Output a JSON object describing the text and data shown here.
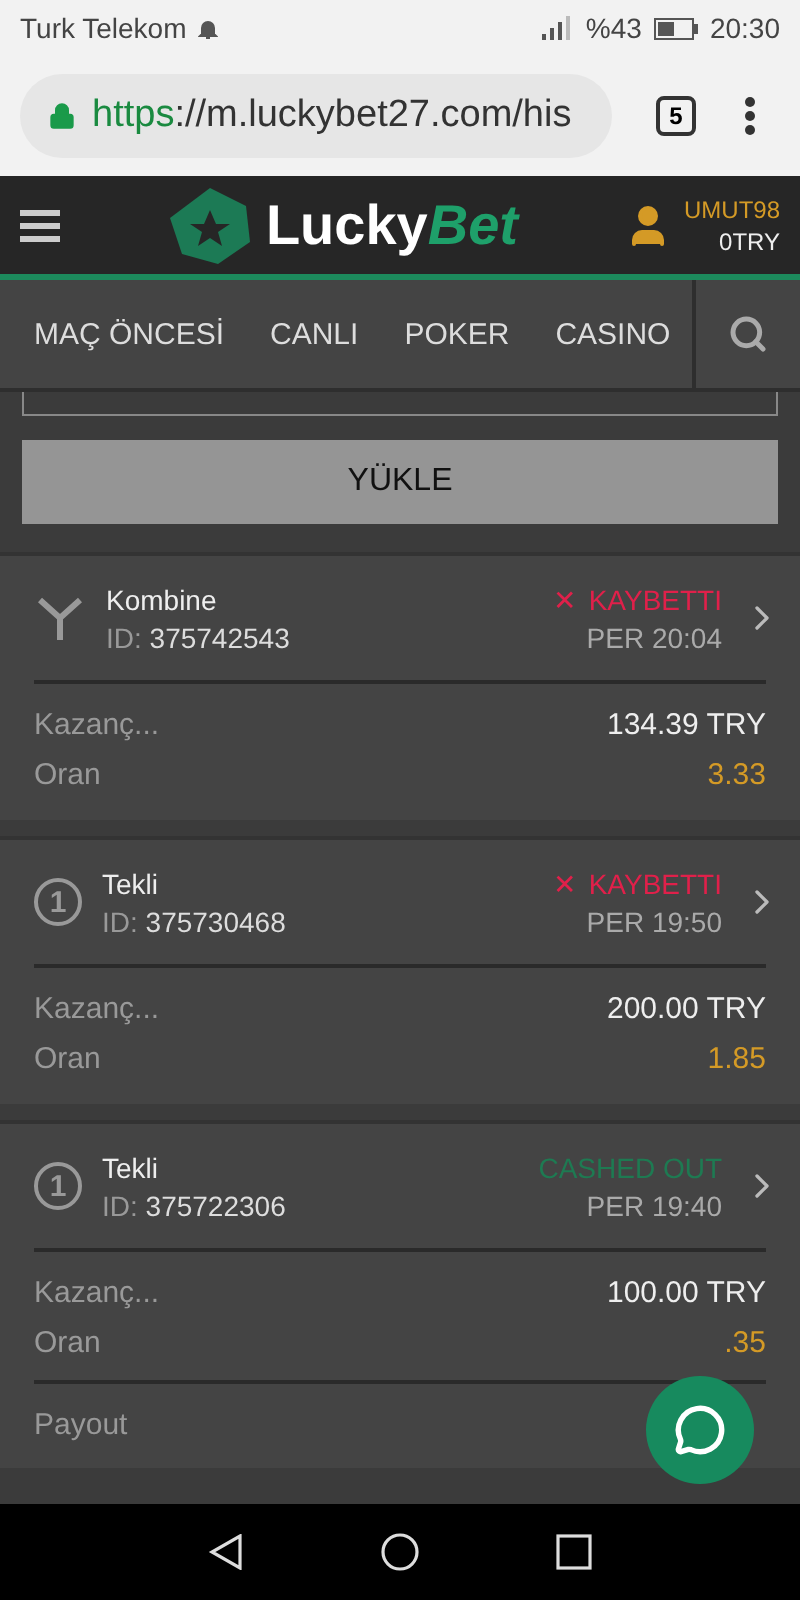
{
  "status_bar": {
    "carrier": "Turk Telekom",
    "battery": "%43",
    "time": "20:30"
  },
  "browser": {
    "url_scheme": "https",
    "url_rest": "://m.luckybet27.com/his",
    "tab_count": "5"
  },
  "header": {
    "logo_first": "Lucky",
    "logo_second": "Bet",
    "username": "UMUT98",
    "balance": "0TRY"
  },
  "nav": [
    {
      "label": "MAÇ ÖNCESİ"
    },
    {
      "label": "CANLI"
    },
    {
      "label": "POKER"
    },
    {
      "label": "CASINO"
    }
  ],
  "load_button": "YÜKLE",
  "bets": [
    {
      "kind": "combo",
      "type": "Kombine",
      "id_label": "ID:",
      "id": "375742543",
      "color": "#e0204a",
      "status_icon": "✕",
      "status_text": "KAYBETTI",
      "date": "PER 20:04",
      "rows": [
        {
          "label": "Kazanç...",
          "value": "134.39 TRY",
          "color": "#eeeeee"
        },
        {
          "label": "Oran",
          "value": "3.33",
          "color": "#d49a26"
        }
      ]
    },
    {
      "kind": "single",
      "type": "Tekli",
      "badge": "1",
      "id_label": "ID:",
      "id": "375730468",
      "color": "#e0204a",
      "status_icon": "✕",
      "status_text": "KAYBETTI",
      "date": "PER 19:50",
      "rows": [
        {
          "label": "Kazanç...",
          "value": "200.00 TRY",
          "color": "#eeeeee"
        },
        {
          "label": "Oran",
          "value": "1.85",
          "color": "#d49a26"
        }
      ]
    },
    {
      "kind": "single",
      "type": "Tekli",
      "badge": "1",
      "id_label": "ID:",
      "id": "375722306",
      "color": "#1e7a52",
      "status_text": "CASHED OUT",
      "date": "PER 19:40",
      "rows": [
        {
          "label": "Kazanç...",
          "value": "100.00 TRY",
          "color": "#eeeeee"
        },
        {
          "label": "Oran",
          "value": ".35",
          "color": "#d49a26"
        }
      ],
      "payout": {
        "label": "Payout"
      }
    }
  ]
}
